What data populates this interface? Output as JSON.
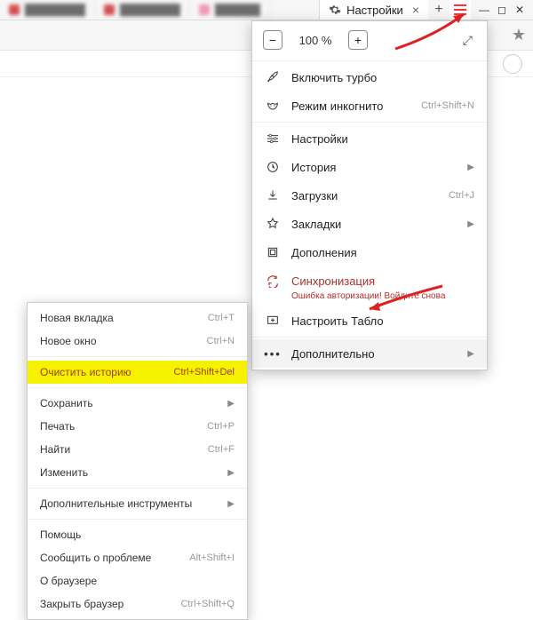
{
  "tabstrip": {
    "settings_tab_label": "Настройки"
  },
  "zoom": {
    "value": "100 %"
  },
  "menu": {
    "turbo": "Включить турбо",
    "incognito": "Режим инкогнито",
    "incognito_shortcut": "Ctrl+Shift+N",
    "settings": "Настройки",
    "history": "История",
    "downloads": "Загрузки",
    "downloads_shortcut": "Ctrl+J",
    "bookmarks": "Закладки",
    "addons": "Дополнения",
    "sync": "Синхронизация",
    "sync_error": "Ошибка авторизации! Войдите снова",
    "tablo": "Настроить Табло",
    "more": "Дополнительно"
  },
  "submenu": {
    "new_tab": {
      "label": "Новая вкладка",
      "shortcut": "Ctrl+T"
    },
    "new_window": {
      "label": "Новое окно",
      "shortcut": "Ctrl+N"
    },
    "clear_history": {
      "label": "Очистить историю",
      "shortcut": "Ctrl+Shift+Del"
    },
    "save": {
      "label": "Сохранить"
    },
    "print": {
      "label": "Печать",
      "shortcut": "Ctrl+P"
    },
    "find": {
      "label": "Найти",
      "shortcut": "Ctrl+F"
    },
    "edit": {
      "label": "Изменить"
    },
    "devtools": {
      "label": "Дополнительные инструменты"
    },
    "help": {
      "label": "Помощь"
    },
    "report": {
      "label": "Сообщить о проблеме",
      "shortcut": "Alt+Shift+I"
    },
    "about": {
      "label": "О браузере"
    },
    "quit": {
      "label": "Закрыть браузер",
      "shortcut": "Ctrl+Shift+Q"
    }
  }
}
